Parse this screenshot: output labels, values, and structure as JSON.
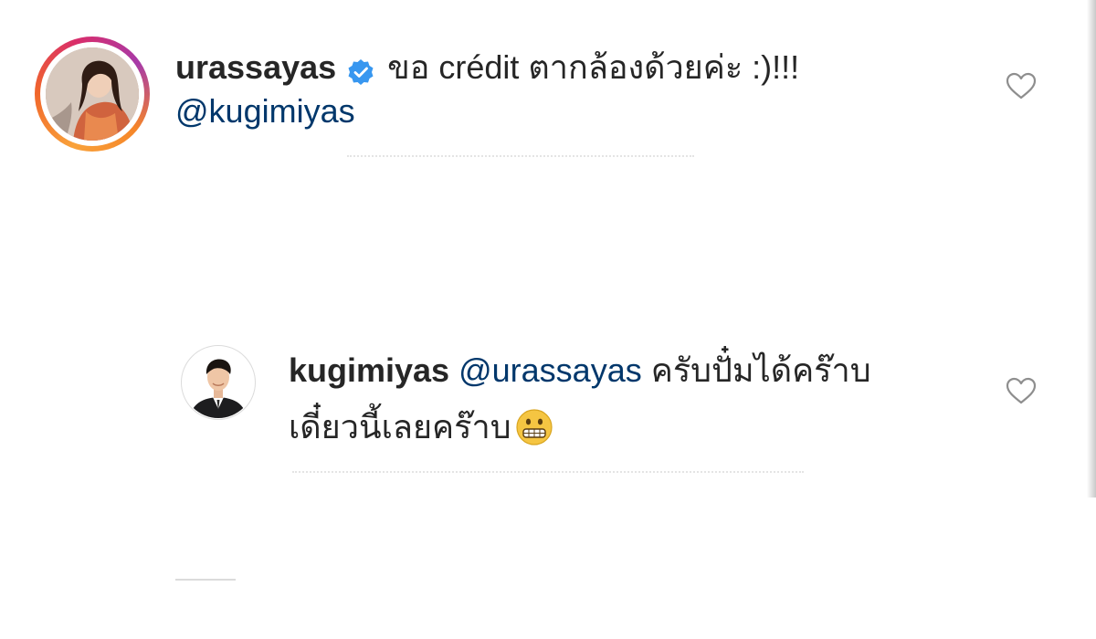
{
  "comments": [
    {
      "username": "urassayas",
      "verified": true,
      "text_line1": "ขอ crédit ตากล้องด้วยค่ะ :)!!!",
      "text_line2": "@kugimiyas",
      "avatar": "profile-photo-woman",
      "has_story_ring": true
    }
  ],
  "replies": [
    {
      "username": "kugimiyas",
      "mention": "@urassayas",
      "text_line1": "ครับปั๋มได้คร๊าบ",
      "text_line2": "เดี๋ยวนี้เลยคร๊าบ",
      "emoji": "grimacing-face-emoji",
      "avatar": "profile-photo-man"
    }
  ],
  "icons": {
    "verified": "verified-badge-icon",
    "like": "heart-outline-icon"
  },
  "colors": {
    "text": "#262626",
    "mention": "#00376b",
    "verified_badge": "#3897f0",
    "heart_stroke": "#8e8e8e"
  }
}
